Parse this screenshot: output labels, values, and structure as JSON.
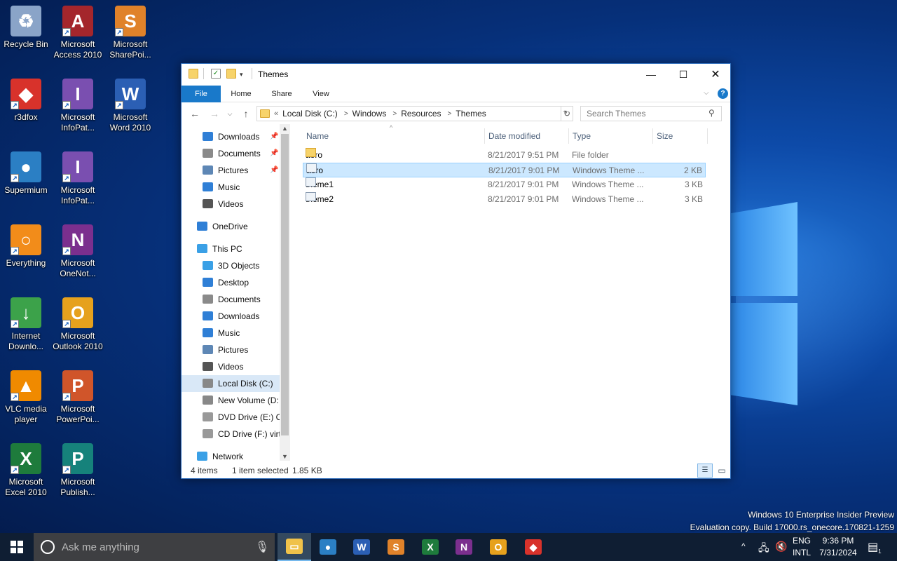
{
  "desktop": {
    "icons": [
      {
        "label": "Recycle Bin",
        "icon": "recycle-bin-icon",
        "color": "#8aa4c8",
        "glyph": "♻"
      },
      {
        "label": "r3dfox",
        "icon": "r3dfox-icon",
        "color": "#d8322b",
        "glyph": "◆"
      },
      {
        "label": "Supermium",
        "icon": "supermium-icon",
        "color": "#2b7fc4",
        "glyph": "●"
      },
      {
        "label": "Everything",
        "icon": "everything-icon",
        "color": "#f28c1a",
        "glyph": "○"
      },
      {
        "label": "Internet Downlo...",
        "icon": "idm-icon",
        "color": "#3ca24a",
        "glyph": "↓"
      },
      {
        "label": "VLC media player",
        "icon": "vlc-icon",
        "color": "#f08a00",
        "glyph": "▲"
      },
      {
        "label": "Microsoft Excel 2010",
        "icon": "excel-icon",
        "color": "#1e7b3c",
        "glyph": "X"
      },
      {
        "label": "Microsoft Access 2010",
        "icon": "access-icon",
        "color": "#a4262c",
        "glyph": "A"
      },
      {
        "label": "Microsoft InfoPat...",
        "icon": "infopath-icon",
        "color": "#7a4fb0",
        "glyph": "I"
      },
      {
        "label": "Microsoft InfoPat...",
        "icon": "infopath-icon",
        "color": "#7a4fb0",
        "glyph": "I"
      },
      {
        "label": "Microsoft OneNot...",
        "icon": "onenote-icon",
        "color": "#7b2f8e",
        "glyph": "N"
      },
      {
        "label": "Microsoft Outlook 2010",
        "icon": "outlook-icon",
        "color": "#e6a11d",
        "glyph": "O"
      },
      {
        "label": "Microsoft PowerPoi...",
        "icon": "powerpoint-icon",
        "color": "#d0552a",
        "glyph": "P"
      },
      {
        "label": "Microsoft Publish...",
        "icon": "publisher-icon",
        "color": "#16827b",
        "glyph": "P"
      },
      {
        "label": "Microsoft SharePoi...",
        "icon": "sharepoint-icon",
        "color": "#e0822a",
        "glyph": "S"
      },
      {
        "label": "Microsoft Word 2010",
        "icon": "word-icon",
        "color": "#2b5fb4",
        "glyph": "W"
      }
    ]
  },
  "window": {
    "title": "Themes",
    "ribbon_tabs": [
      "File",
      "Home",
      "Share",
      "View"
    ],
    "breadcrumb": [
      "Local Disk (C:)",
      "Windows",
      "Resources",
      "Themes"
    ],
    "breadcrumb_prefix": "«",
    "search_placeholder": "Search Themes",
    "nav": [
      {
        "label": "Downloads",
        "icon": "downloads-icon",
        "pinned": true
      },
      {
        "label": "Documents",
        "icon": "documents-icon",
        "pinned": true
      },
      {
        "label": "Pictures",
        "icon": "pictures-icon",
        "pinned": true
      },
      {
        "label": "Music",
        "icon": "music-icon",
        "pinned": false
      },
      {
        "label": "Videos",
        "icon": "videos-icon",
        "pinned": false
      },
      {
        "label": "OneDrive",
        "icon": "onedrive-icon",
        "pinned": false
      },
      {
        "label": "This PC",
        "icon": "this-pc-icon",
        "pinned": false
      },
      {
        "label": "3D Objects",
        "icon": "3d-objects-icon",
        "pinned": false
      },
      {
        "label": "Desktop",
        "icon": "desktop-icon",
        "pinned": false
      },
      {
        "label": "Documents",
        "icon": "documents-icon",
        "pinned": false
      },
      {
        "label": "Downloads",
        "icon": "downloads-icon",
        "pinned": false
      },
      {
        "label": "Music",
        "icon": "music-icon",
        "pinned": false
      },
      {
        "label": "Pictures",
        "icon": "pictures-icon",
        "pinned": false
      },
      {
        "label": "Videos",
        "icon": "videos-icon",
        "pinned": false
      },
      {
        "label": "Local Disk (C:)",
        "icon": "drive-icon",
        "pinned": false
      },
      {
        "label": "New Volume (D:",
        "icon": "drive-icon",
        "pinned": false
      },
      {
        "label": "DVD Drive (E:) O",
        "icon": "dvd-drive-icon",
        "pinned": false
      },
      {
        "label": "CD Drive (F:) virt",
        "icon": "cd-drive-icon",
        "pinned": false
      },
      {
        "label": "Network",
        "icon": "network-icon",
        "pinned": false
      }
    ],
    "columns": [
      "Name",
      "Date modified",
      "Type",
      "Size"
    ],
    "files": [
      {
        "name": "aero",
        "date": "8/21/2017 9:51 PM",
        "type": "File folder",
        "size": "",
        "icon": "folder-icon"
      },
      {
        "name": "aero",
        "date": "8/21/2017 9:01 PM",
        "type": "Windows Theme ...",
        "size": "2 KB",
        "icon": "theme-file-icon"
      },
      {
        "name": "theme1",
        "date": "8/21/2017 9:01 PM",
        "type": "Windows Theme ...",
        "size": "3 KB",
        "icon": "theme-file-icon"
      },
      {
        "name": "theme2",
        "date": "8/21/2017 9:01 PM",
        "type": "Windows Theme ...",
        "size": "3 KB",
        "icon": "theme-file-icon"
      }
    ],
    "status": {
      "count": "4 items",
      "selected": "1 item selected",
      "size": "1.85 KB"
    }
  },
  "watermark": {
    "line1": "Windows 10 Enterprise Insider Preview",
    "line2": "Evaluation copy. Build 17000.rs_onecore.170821-1259"
  },
  "taskbar": {
    "search_placeholder": "Ask me anything",
    "apps": [
      {
        "name": "file-explorer",
        "color": "#f0c24a",
        "glyph": "▭"
      },
      {
        "name": "supermium",
        "color": "#2b7fc4",
        "glyph": "●"
      },
      {
        "name": "word",
        "color": "#2b5fb4",
        "glyph": "W"
      },
      {
        "name": "sharepoint",
        "color": "#e0822a",
        "glyph": "S"
      },
      {
        "name": "excel",
        "color": "#1e7b3c",
        "glyph": "X"
      },
      {
        "name": "onenote",
        "color": "#7b2f8e",
        "glyph": "N"
      },
      {
        "name": "outlook",
        "color": "#e6a11d",
        "glyph": "O"
      },
      {
        "name": "r3dfox",
        "color": "#d8322b",
        "glyph": "◆"
      }
    ],
    "lang1": "ENG",
    "lang2": "INTL",
    "time": "9:36 PM",
    "date": "7/31/2024",
    "notifications": "1"
  }
}
